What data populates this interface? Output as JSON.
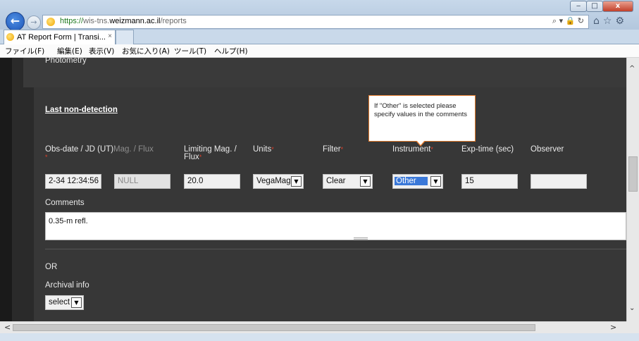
{
  "window": {
    "minimize_glyph": "‒",
    "maximize_glyph": "□",
    "close_glyph": "x"
  },
  "nav": {
    "back_glyph": "←",
    "forward_glyph": "→"
  },
  "address": {
    "protocol": "https://",
    "subdomain": "wis-tns.",
    "domain": "weizmann.ac.il",
    "path": "/reports",
    "icons": "⌕ ▾ 🔒 ↻"
  },
  "toolbar": {
    "icons": "⌂☆⚙"
  },
  "tabs": [
    {
      "label": "AT Report Form | Transi...",
      "close": "×"
    }
  ],
  "menu": {
    "file": "ファイル(F)",
    "edit": "編集(E)",
    "view": "表示(V)",
    "favorites": "お気に入り(A)",
    "tools": "ツール(T)",
    "help": "ヘルプ(H)"
  },
  "page": {
    "photometry_heading": "Photometry",
    "section_title": "Last non-detection",
    "tooltip": "If \"Other\" is selected please specify values in the comments",
    "labels": {
      "obs_date": "Obs-date / JD (UT)",
      "mag_flux": "Mag. / Flux",
      "limiting_mag_line1": "Limiting Mag. /",
      "limiting_mag_line2": "Flux",
      "units": "Units",
      "filter": "Filter",
      "instrument": "Instrument",
      "exp_time": "Exp-time (sec)",
      "observer": "Observer",
      "required_mark": "*"
    },
    "fields": {
      "obs_date_value": "2-34 12:34:56",
      "mag_flux_value": "NULL",
      "limiting_mag_value": "20.0",
      "units_selected": "VegaMag",
      "filter_selected": "Clear",
      "instrument_selected": "Other",
      "exp_time_value": "15",
      "observer_value": ""
    },
    "comments_label": "Comments",
    "comments_value": "0.35-m refl.",
    "or_label": "OR",
    "archival_label": "Archival info",
    "archival_selected": "select"
  },
  "scroll": {
    "up": "^",
    "down": "⌄",
    "left": "<",
    "right": ">"
  },
  "colors": {
    "accent_blue": "#3a78d8",
    "tooltip_border": "#e47a2c",
    "required_red": "#e0402a",
    "panel_bg": "#373737"
  }
}
